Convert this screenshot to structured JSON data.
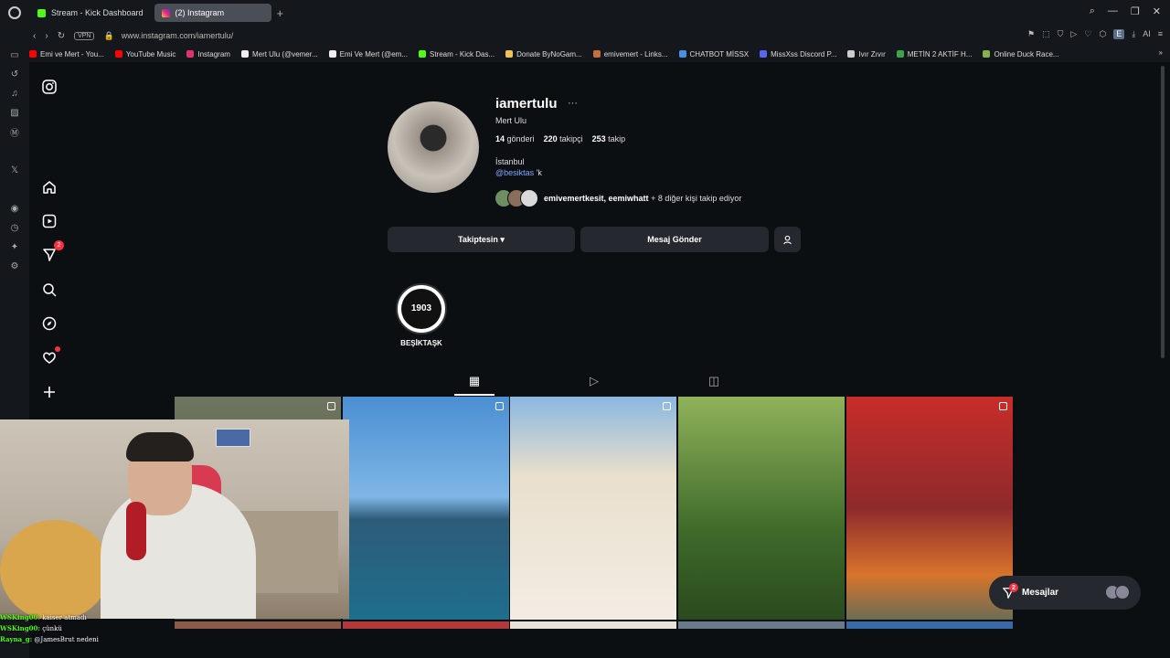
{
  "browser": {
    "tabs": [
      {
        "label": "Stream - Kick Dashboard",
        "favicon": "kick-icon"
      },
      {
        "label": "(2) Instagram",
        "favicon": "instagram-icon"
      }
    ],
    "new_tab": "+",
    "vpn": "VPN",
    "url": "www.instagram.com/iamertulu/",
    "ext_letter": "E",
    "ai_label": "AI",
    "bookmarks": [
      {
        "label": "Emi ve Mert - You...",
        "color": "#ff0000"
      },
      {
        "label": "YouTube Music",
        "color": "#ff0000"
      },
      {
        "label": "Instagram",
        "color": "#e1306c"
      },
      {
        "label": "Mert Ulu (@vemer...",
        "color": "#eeeeee"
      },
      {
        "label": "Emi Ve Mert (@em...",
        "color": "#eeeeee"
      },
      {
        "label": "Stream - Kick Das...",
        "color": "#53fc18"
      },
      {
        "label": "Donate ByNoGam...",
        "color": "#f2c14e"
      },
      {
        "label": "emivemert - Links...",
        "color": "#c96e3a"
      },
      {
        "label": "CHATBOT MİSSX",
        "color": "#4a90e2"
      },
      {
        "label": "MissXss Discord P...",
        "color": "#5865f2"
      },
      {
        "label": "Ivır Zıvır",
        "color": "#cccccc"
      },
      {
        "label": "METİN 2 AKTİF H...",
        "color": "#3aa54a"
      },
      {
        "label": "Online Duck Race...",
        "color": "#88b04b"
      }
    ]
  },
  "profile": {
    "username": "iamertulu",
    "more": "···",
    "full_name": "Mert Ulu",
    "posts_count": "14",
    "posts_label": "gönderi",
    "followers_count": "220",
    "followers_label": "takipçi",
    "following_count": "253",
    "following_label": "takip",
    "bio_line1": "İstanbul",
    "bio_mention": "@besiktas",
    "bio_suffix": " 'k",
    "followed_by_names": "emivemertkesit, eemiwhatt",
    "followed_by_rest": " + 8 diğer kişi takip ediyor"
  },
  "actions": {
    "following": "Takiptesin ▾",
    "message": "Mesaj Gönder",
    "add_person": "+👤"
  },
  "highlight": {
    "label": "BEŞİKTAŞK",
    "badge_text": "1903"
  },
  "nav": {
    "notifications_badge": "2"
  },
  "chat": [
    {
      "name": "WSKing00:",
      "text": "kaiser atmadı"
    },
    {
      "name": "WSKing00:",
      "text": "çünkü"
    },
    {
      "name": "Rayna_g:",
      "text": "@JamesBrut nedeni"
    }
  ],
  "messages": {
    "label": "Mesajlar",
    "badge": "2"
  },
  "grid_colors": [
    "#5c6a52",
    "#3a7fb0",
    "#d9cbb4",
    "#4d7a35",
    "#c9322f"
  ]
}
